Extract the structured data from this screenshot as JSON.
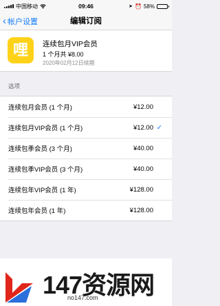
{
  "status_bar": {
    "carrier": "中国移动",
    "time": "09:46",
    "battery": "58%",
    "battery_level": 0.58
  },
  "nav": {
    "back_label": "帐户设置",
    "title": "编辑订阅"
  },
  "subscription": {
    "app_icon_glyph": "哩",
    "title": "连续包月VIP会员",
    "detail": "1 个月共 ¥8.00",
    "renewal": "2020年02月12日续期"
  },
  "options_header": "选项",
  "options": [
    {
      "name": "连续包月会员 (1 个月)",
      "price": "¥12.00",
      "selected": false
    },
    {
      "name": "连续包月VIP会员 (1 个月)",
      "price": "¥12.00",
      "selected": true
    },
    {
      "name": "连续包季会员 (3 个月)",
      "price": "¥40.00",
      "selected": false
    },
    {
      "name": "连续包季VIP会员 (3 个月)",
      "price": "¥40.00",
      "selected": false
    },
    {
      "name": "连续包年VIP会员 (1 年)",
      "price": "¥128.00",
      "selected": false
    },
    {
      "name": "连续包年会员 (1 年)",
      "price": "¥128.00",
      "selected": false
    }
  ],
  "watermark": {
    "text": "147资源网",
    "url": "no147.com"
  },
  "colors": {
    "accent": "#157efb",
    "icon_bg": "#ffd21a"
  }
}
